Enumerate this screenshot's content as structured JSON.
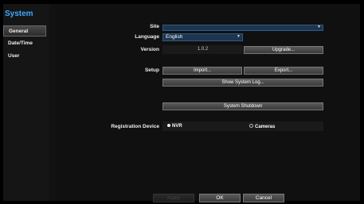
{
  "sidebar": {
    "title": "System",
    "items": [
      {
        "label": "General",
        "active": true
      },
      {
        "label": "Date/Time",
        "active": false
      },
      {
        "label": "User",
        "active": false
      }
    ]
  },
  "form": {
    "site_label": "Site",
    "site_value": "",
    "language_label": "Language",
    "language_value": "English",
    "version_label": "Version",
    "version_value": "1.0.2",
    "upgrade_button": "Upgrade...",
    "setup_label": "Setup",
    "import_button": "Import...",
    "export_button": "Export...",
    "show_log_button": "Show System Log...",
    "shutdown_button": "System Shutdown",
    "registration_label": "Registration Device",
    "registration_options": [
      "NVR",
      "Cameras"
    ],
    "registration_selected": "NVR"
  },
  "footer": {
    "apply": "Apply",
    "ok": "OK",
    "cancel": "Cancel"
  },
  "colors": {
    "accent": "#3fa9ff",
    "field_bg": "#1d3550"
  }
}
